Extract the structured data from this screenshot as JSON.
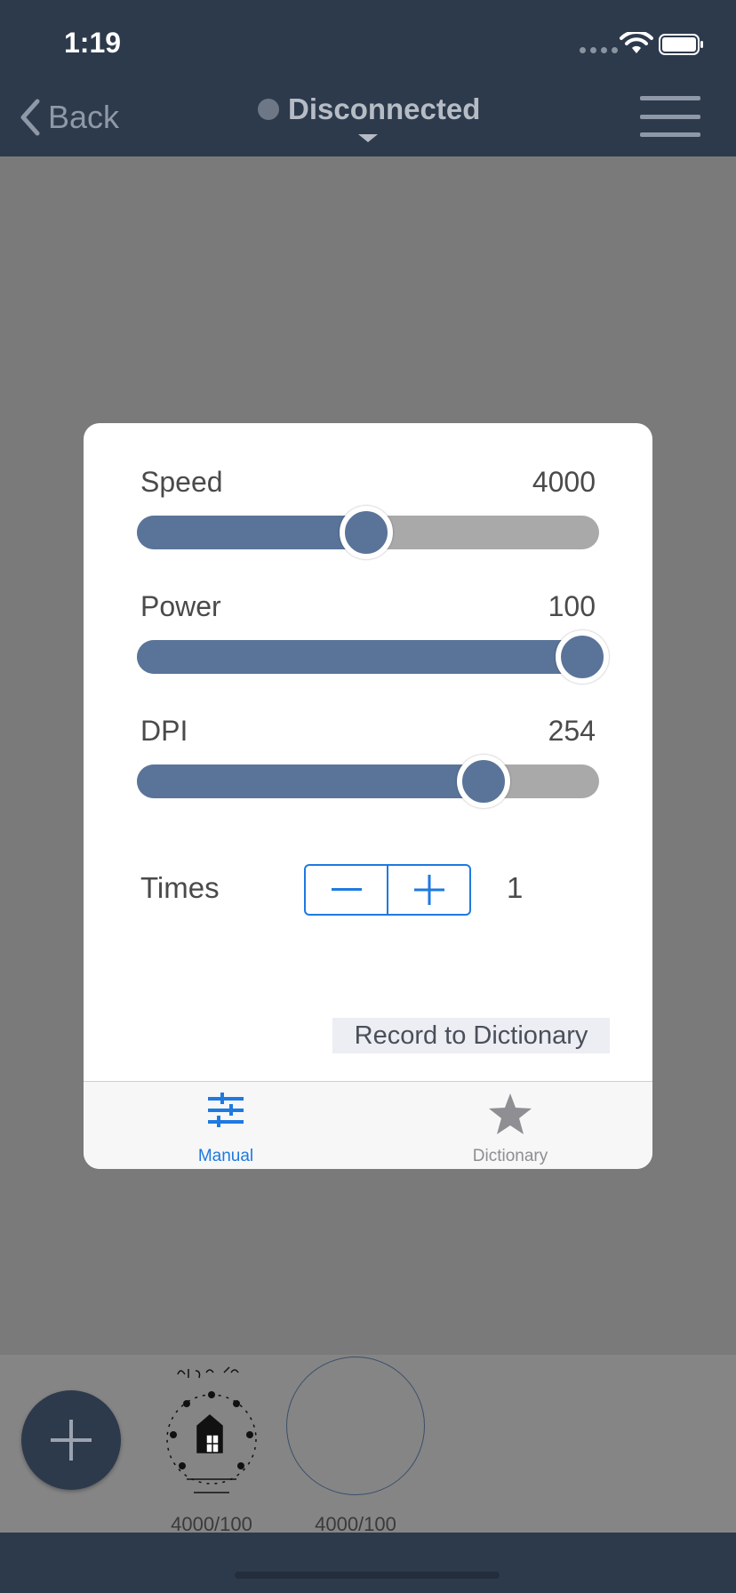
{
  "status_bar": {
    "time": "1:19"
  },
  "nav": {
    "back_label": "Back",
    "connection_status": "Disconnected"
  },
  "controls": {
    "speed": {
      "label": "Speed",
      "value": "4000",
      "fraction": 0.495
    },
    "power": {
      "label": "Power",
      "value": "100",
      "fraction": 1.0
    },
    "dpi": {
      "label": "DPI",
      "value": "254",
      "fraction": 0.77
    },
    "times": {
      "label": "Times",
      "value": "1",
      "minus": "—",
      "plus": "+"
    },
    "record_button": "Record to Dictionary"
  },
  "tabs": [
    {
      "label": "Manual",
      "icon": "sliders-icon",
      "active": true
    },
    {
      "label": "Dictionary",
      "icon": "star-icon",
      "active": false
    }
  ],
  "tray": {
    "items": [
      {
        "label": "4000/100",
        "thumbnail": "room-key-stamp"
      },
      {
        "label": "4000/100",
        "thumbnail": "circle-outline"
      }
    ]
  },
  "colors": {
    "nav_bg": "#2d3a4c",
    "accent": "#1e7ae0",
    "slider_fill": "#5a7499",
    "slider_track": "#a9a9a9"
  }
}
